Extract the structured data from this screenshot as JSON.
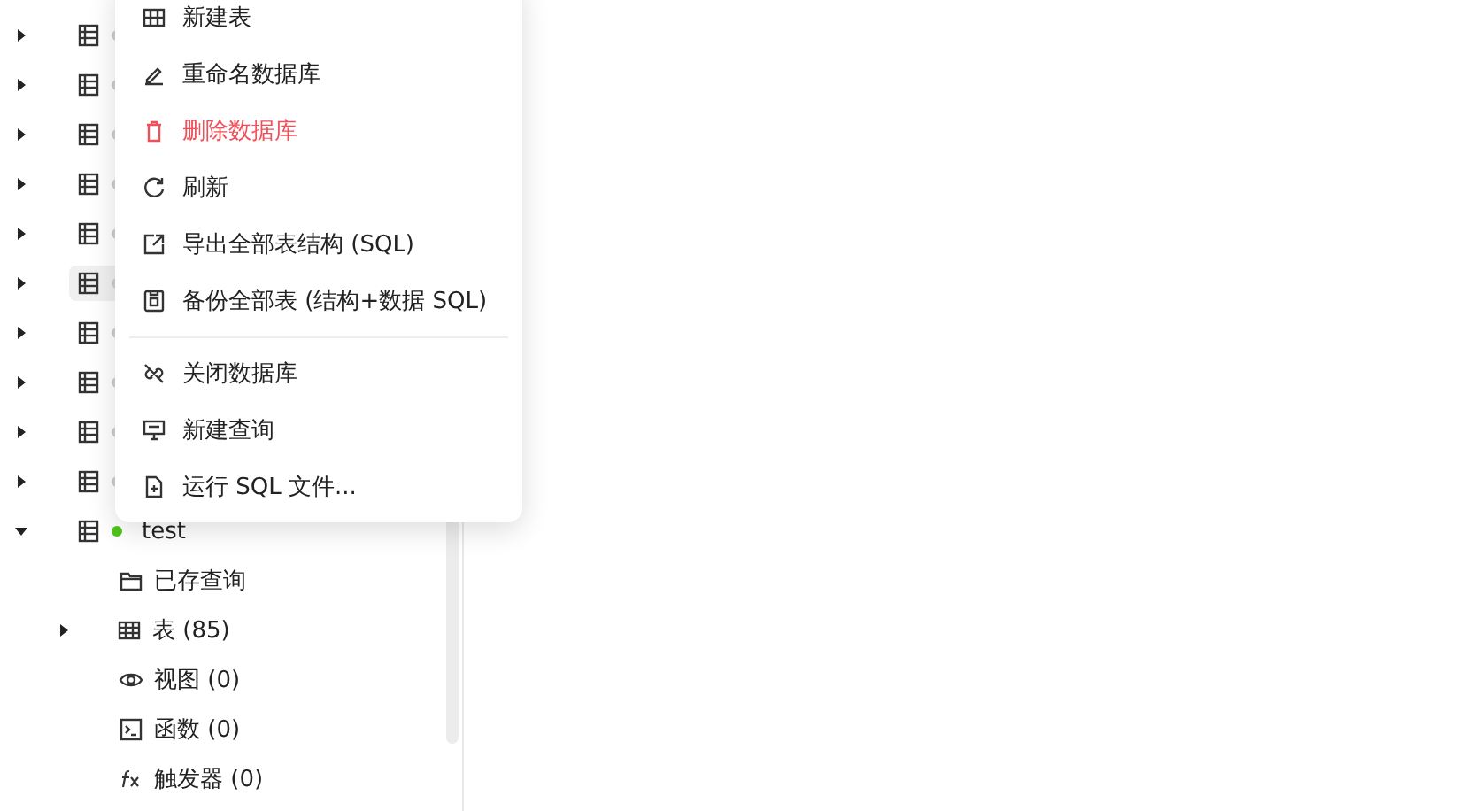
{
  "tree": [
    {
      "kind": "database",
      "connected": false,
      "selected": false,
      "expanded": false
    },
    {
      "kind": "database",
      "connected": false,
      "selected": false,
      "expanded": false
    },
    {
      "kind": "database",
      "connected": false,
      "selected": false,
      "expanded": false
    },
    {
      "kind": "database",
      "connected": false,
      "selected": false,
      "expanded": false
    },
    {
      "kind": "database",
      "connected": false,
      "selected": false,
      "expanded": false
    },
    {
      "kind": "database",
      "connected": false,
      "selected": true,
      "expanded": false
    },
    {
      "kind": "database",
      "connected": false,
      "selected": false,
      "expanded": false
    },
    {
      "kind": "database",
      "connected": false,
      "selected": false,
      "expanded": false
    },
    {
      "kind": "database",
      "connected": false,
      "selected": false,
      "expanded": false
    },
    {
      "kind": "database",
      "connected": false,
      "selected": false,
      "expanded": false
    },
    {
      "kind": "database",
      "name": "test",
      "connected": true,
      "selected": false,
      "expanded": true,
      "children": [
        {
          "kind": "saved_queries",
          "label": "已存查询",
          "expandable": false
        },
        {
          "kind": "tables",
          "label": "表 (85)",
          "expandable": true
        },
        {
          "kind": "views",
          "label": "视图 (0)",
          "expandable": false
        },
        {
          "kind": "functions",
          "label": "函数 (0)",
          "expandable": false
        },
        {
          "kind": "triggers",
          "label": "触发器 (0)",
          "expandable": false
        }
      ]
    }
  ],
  "context_menu": [
    {
      "kind": "item",
      "label": "新建表",
      "danger": false
    },
    {
      "kind": "item",
      "label": "重命名数据库",
      "danger": false
    },
    {
      "kind": "item",
      "label": "删除数据库",
      "danger": true
    },
    {
      "kind": "item",
      "label": "刷新",
      "danger": false
    },
    {
      "kind": "item",
      "label": "导出全部表结构 (SQL)",
      "danger": false
    },
    {
      "kind": "item",
      "label": "备份全部表 (结构+数据 SQL)",
      "danger": false
    },
    {
      "kind": "divider"
    },
    {
      "kind": "item",
      "label": "关闭数据库",
      "danger": false
    },
    {
      "kind": "item",
      "label": "新建查询",
      "danger": false
    },
    {
      "kind": "item",
      "label": "运行 SQL 文件...",
      "danger": false
    }
  ]
}
